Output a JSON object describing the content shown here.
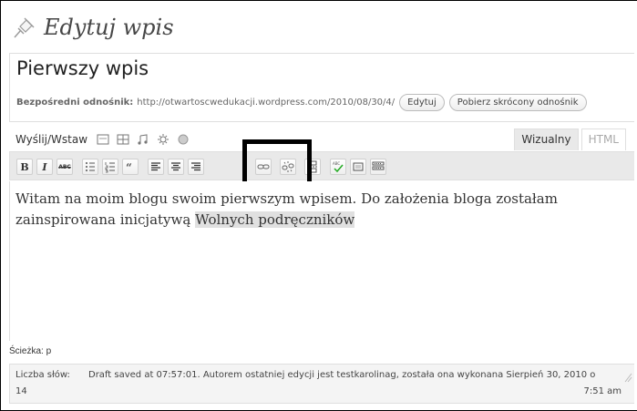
{
  "header": {
    "title": "Edytuj wpis",
    "icon": "pushpin-icon"
  },
  "post": {
    "title": "Pierwszy wpis"
  },
  "permalink": {
    "label": "Bezpośredni odnośnik:",
    "url": "http://otwartoscwedukacji.wordpress.com/2010/08/30/4/",
    "edit_button": "Edytuj",
    "shortlink_button": "Pobierz skrócony odnośnik"
  },
  "upload": {
    "label": "Wyślij/Wstaw",
    "icons": [
      "image-icon",
      "video-icon",
      "audio-icon",
      "media-icon",
      "poll-icon"
    ]
  },
  "mode_tabs": {
    "visual": "Wizualny",
    "html": "HTML"
  },
  "toolbar": {
    "buttons": [
      "bold-icon",
      "italic-icon",
      "strikethrough-icon",
      "bullet-list-icon",
      "numbered-list-icon",
      "blockquote-icon",
      "align-left-icon",
      "align-center-icon",
      "align-right-icon",
      "link-icon",
      "unlink-icon",
      "more-tag-icon",
      "spellcheck-icon",
      "fullscreen-icon",
      "kitchen-sink-icon"
    ],
    "bold_label": "B",
    "italic_label": "I",
    "strike_label": "ABC"
  },
  "editor": {
    "text_before": "Witam na moim blogu swoim pierwszym wpisem. Do założenia bloga zostałam zainspirowana inicjatywą ",
    "link_text": "Wolnych podręczników"
  },
  "path": {
    "label": "Ścieżka: p"
  },
  "status": {
    "word_count_label": "Liczba słów:",
    "word_count": "14",
    "draft_info_line1": "Draft saved at 07:57:01. Autorem ostatniej edycji jest testkarolinag, została ona wykonana Sierpień 30, 2010 o",
    "draft_info_line2": "7:51 am"
  },
  "colors": {
    "highlight_border": "#000000",
    "toolbar_bg": "#e9e9e9",
    "link_highlight": "#e0e0e0"
  }
}
